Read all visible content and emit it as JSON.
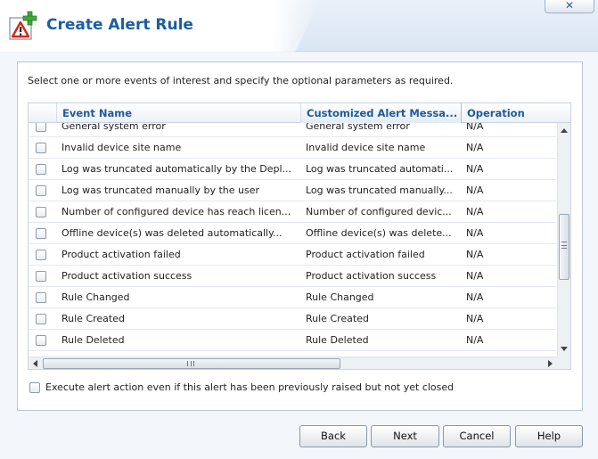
{
  "window": {
    "title": "Create Alert Rule",
    "close_glyph": "✕"
  },
  "instruction": "Select one or more events of interest and specify the optional parameters as required.",
  "grid": {
    "columns": {
      "event_name": "Event Name",
      "custom_message": "Customized Alert Messa...",
      "operation": "Operation"
    },
    "rows": [
      {
        "event": "General system error",
        "message": "General system error",
        "operation": "N/A"
      },
      {
        "event": "Invalid device site name",
        "message": "Invalid device site name",
        "operation": "N/A"
      },
      {
        "event": "Log was truncated automatically by the Depl...",
        "message": "Log was truncated automati...",
        "operation": "N/A"
      },
      {
        "event": "Log was truncated manually by the user",
        "message": "Log was truncated manually...",
        "operation": "N/A"
      },
      {
        "event": "Number of configured device has reach licen...",
        "message": "Number of configured devic...",
        "operation": "N/A"
      },
      {
        "event": "Offline device(s) was deleted automatically...",
        "message": "Offline device(s) was delete...",
        "operation": "N/A"
      },
      {
        "event": "Product activation failed",
        "message": "Product activation failed",
        "operation": "N/A"
      },
      {
        "event": "Product activation success",
        "message": "Product activation success",
        "operation": "N/A"
      },
      {
        "event": "Rule Changed",
        "message": "Rule Changed",
        "operation": "N/A"
      },
      {
        "event": "Rule Created",
        "message": "Rule Created",
        "operation": "N/A"
      },
      {
        "event": "Rule Deleted",
        "message": "Rule Deleted",
        "operation": "N/A"
      }
    ],
    "scroll_grip_glyph": "III"
  },
  "execute_option": {
    "label": "Execute alert action even if this alert has been previously raised but not yet closed",
    "checked": false
  },
  "buttons": {
    "back": "Back",
    "next": "Next",
    "cancel": "Cancel",
    "help": "Help"
  },
  "colors": {
    "title": "#1b5ea3",
    "column_header": "#1e5b9a",
    "icon_plus": "#3fa83a",
    "icon_warning": "#d9261c"
  },
  "icons": {
    "title_icon": "alert-rule-add-icon",
    "close": "close-icon"
  }
}
